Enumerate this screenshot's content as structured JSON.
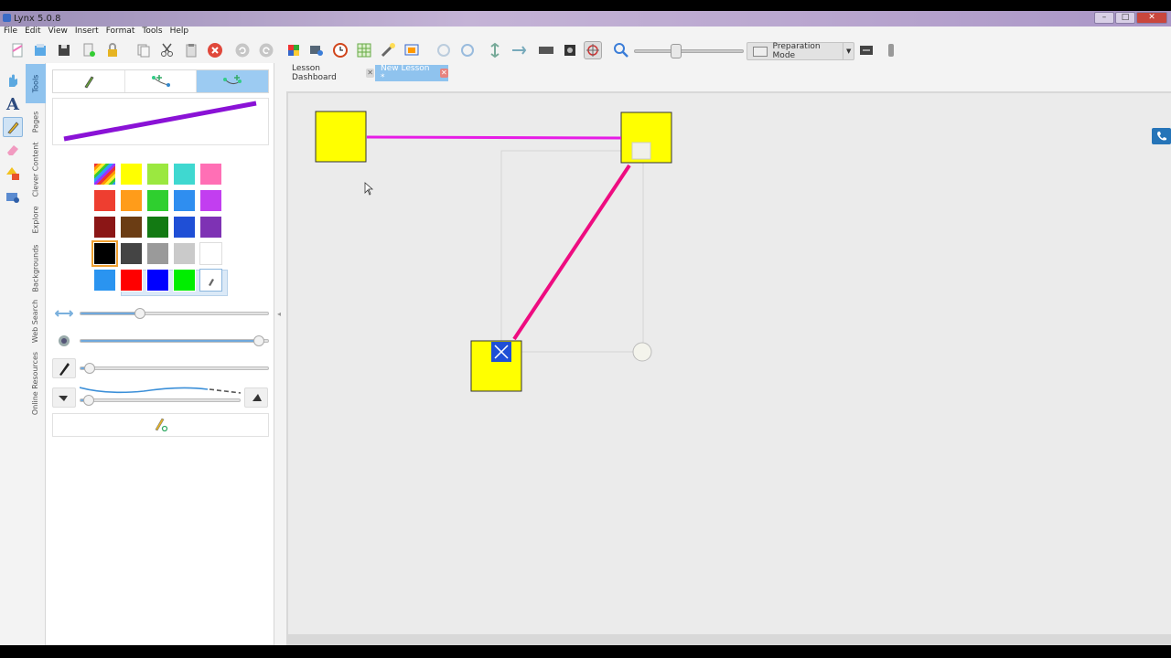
{
  "window": {
    "title": "Lynx 5.0.8",
    "minimize": "–",
    "maximize": "□",
    "close": "✕"
  },
  "menu": [
    "File",
    "Edit",
    "View",
    "Insert",
    "Format",
    "Tools",
    "Help"
  ],
  "toolbar": {
    "mode_label": "Preparation Mode",
    "icons": [
      "new-icon",
      "open-icon",
      "save-icon",
      "export-icon",
      "lock-icon",
      "copy-icon",
      "cut-icon",
      "paste-icon",
      "delete-icon",
      "undo-icon",
      "redo-icon",
      "gallery-icon",
      "screen-record-icon",
      "clock-icon",
      "table-icon",
      "spotlight-icon",
      "reveal-icon",
      "rotate-left-icon",
      "rotate-right-icon",
      "align-icon",
      "distribute-icon",
      "keyboard-icon",
      "screenshot-icon",
      "select-icon",
      "zoom-icon",
      "screen-icon",
      "remote-icon"
    ]
  },
  "side_tools": [
    "hand-icon",
    "text-icon",
    "pen-icon",
    "eraser-icon",
    "shapes-icon",
    "media-icon"
  ],
  "vertical_tabs": [
    "Tools",
    "Pages",
    "Clever Content",
    "Explore",
    "Backgrounds",
    "Web Search",
    "Online Resources"
  ],
  "pen_panel": {
    "mode_tabs": [
      "pen-mode",
      "connector-mode",
      "smart-connector-mode"
    ],
    "active_mode": 2,
    "preview_color": "#8a12d6",
    "swatches": [
      "rainbow",
      "#ffff00",
      "#9be840",
      "#3fd8d0",
      "#ff6fb5",
      "#ee3e30",
      "#ff9c1a",
      "#2fcf2f",
      "#2f8ef0",
      "#c23ef0",
      "#8b1616",
      "#6b3d14",
      "#137a13",
      "#1f4fd6",
      "#7e32b4",
      "#000000",
      "#444444",
      "#9a9a9a",
      "#cacaca",
      "#ffffff",
      "#2a94f0",
      "#ff0000",
      "#0000ff",
      "#00ee00",
      "picker"
    ],
    "selected_swatch": 15,
    "width_level": 0.3,
    "opacity_level": 0.97,
    "smoothing_level": 0.02,
    "dash_level": 0.02
  },
  "tabs": [
    {
      "label": "Lesson Dashboard",
      "close": "✕"
    },
    {
      "label": "New Lesson *",
      "close": "✕"
    }
  ],
  "colors": {
    "accent": "#8fc3ee",
    "shape_fill": "#ffff00",
    "connector_magenta": "#e61ce6",
    "connector_pink": "#ee0c80",
    "handle_blue": "#1f4fd6"
  }
}
